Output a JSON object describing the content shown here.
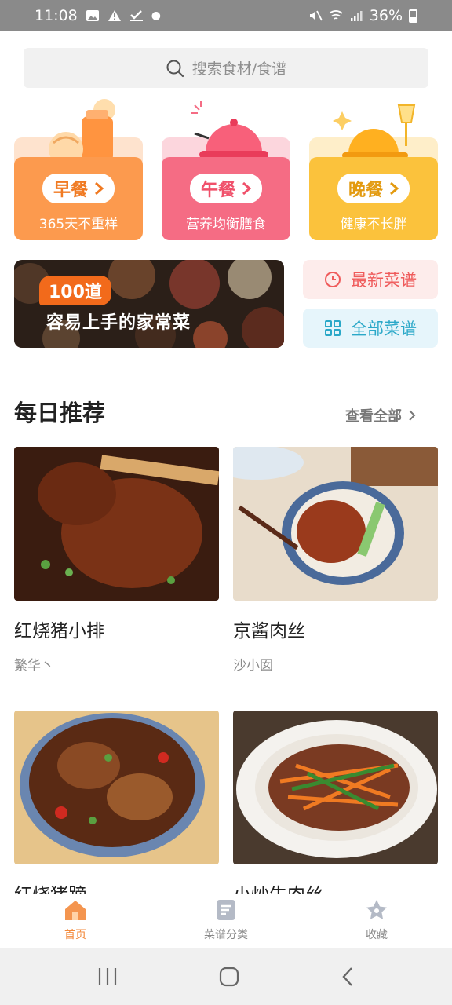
{
  "status_bar": {
    "time": "11:08",
    "battery": "36%"
  },
  "search": {
    "placeholder": "搜索食材/食谱"
  },
  "meals": [
    {
      "title": "早餐",
      "subtitle": "365天不重样",
      "color": "#fc9a4e",
      "text_color": "#f07a22"
    },
    {
      "title": "午餐",
      "subtitle": "营养均衡膳食",
      "color": "#f56c84",
      "text_color": "#f0506a"
    },
    {
      "title": "晚餐",
      "subtitle": "健康不长胖",
      "color": "#fbc23c",
      "text_color": "#e39a10"
    }
  ],
  "banner": {
    "badge": "100道",
    "text": "容易上手的家常菜"
  },
  "quick_links": {
    "latest": {
      "label": "最新菜谱",
      "color": "#ef5b5b",
      "bg": "#fdeceb"
    },
    "all": {
      "label": "全部菜谱",
      "color": "#2aa8c8",
      "bg": "#e6f5fb"
    }
  },
  "daily": {
    "title": "每日推荐",
    "see_all": "查看全部"
  },
  "dishes": [
    {
      "name": "红烧猪小排",
      "author": "繁华丶"
    },
    {
      "name": "京酱肉丝",
      "author": "沙小囡"
    },
    {
      "name": "红烧猪蹄",
      "author": ""
    },
    {
      "name": "小炒牛肉丝",
      "author": ""
    }
  ],
  "tabs": [
    {
      "label": "首页",
      "icon": "home-icon"
    },
    {
      "label": "菜谱分类",
      "icon": "recipe-book-icon"
    },
    {
      "label": "收藏",
      "icon": "star-icon"
    }
  ]
}
